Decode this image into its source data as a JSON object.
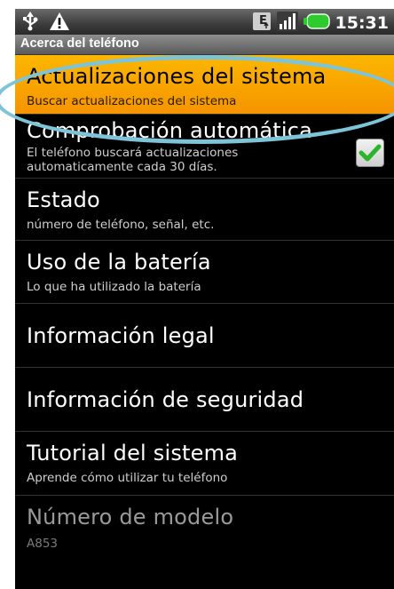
{
  "status_bar": {
    "time": "15:31",
    "icons": [
      "usb-icon",
      "warning-icon",
      "edge-network-icon",
      "signal-icon",
      "battery-icon"
    ]
  },
  "title": "Acerca del teléfono",
  "items": [
    {
      "title": "Actualizaciones del sistema",
      "subtitle": "Buscar actualizaciones del sistema",
      "selected": true
    },
    {
      "title": "Comprobación automática",
      "subtitle_line1": "El teléfono buscará actualizaciones",
      "subtitle_line2": "automaticamente cada 30 días.",
      "checked": true
    },
    {
      "title": "Estado",
      "subtitle": "número de teléfono, señal, etc."
    },
    {
      "title": "Uso de la batería",
      "subtitle": "Lo que ha utilizado la batería"
    },
    {
      "title": "Información legal"
    },
    {
      "title": "Información de seguridad"
    },
    {
      "title": "Tutorial del sistema",
      "subtitle": "Aprende cómo utilizar tu teléfono"
    },
    {
      "title": "Número de modelo",
      "subtitle": "A853",
      "disabled": true
    }
  ],
  "colors": {
    "highlight": "#f7a800",
    "callout": "#7ec4d8",
    "check": "#2ab52a"
  }
}
